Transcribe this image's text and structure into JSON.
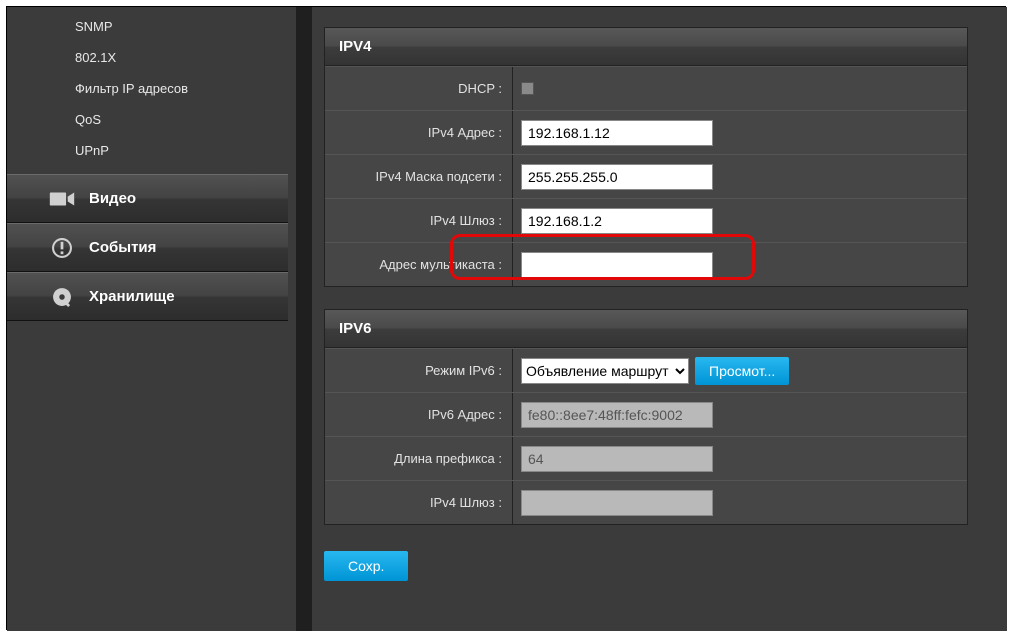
{
  "sidebar": {
    "sub_items": [
      "SNMP",
      "802.1X",
      "Фильтр IP адресов",
      "QoS",
      "UPnP"
    ],
    "nav": [
      {
        "icon": "camera-icon",
        "label": "Видео"
      },
      {
        "icon": "alert-icon",
        "label": "События"
      },
      {
        "icon": "disk-icon",
        "label": "Хранилище"
      }
    ]
  },
  "ipv4": {
    "title": "IPV4",
    "dhcp_label": "DHCP :",
    "addr_label": "IPv4 Адрес :",
    "addr_value": "192.168.1.12",
    "mask_label": "IPv4 Маска подсети :",
    "mask_value": "255.255.255.0",
    "gw_label": "IPv4 Шлюз :",
    "gw_value": "192.168.1.2",
    "mc_label": "Адрес мультикаста :",
    "mc_value": ""
  },
  "ipv6": {
    "title": "IPV6",
    "mode_label": "Режим IPv6 :",
    "mode_value": "Объявление маршрут",
    "view_btn": "Просмот...",
    "addr_label": "IPv6 Адрес :",
    "addr_value": "fe80::8ee7:48ff:fefc:9002",
    "prefix_label": "Длина префикса :",
    "prefix_value": "64",
    "gw_label": "IPv4 Шлюз :",
    "gw_value": ""
  },
  "save_label": "Сохр."
}
